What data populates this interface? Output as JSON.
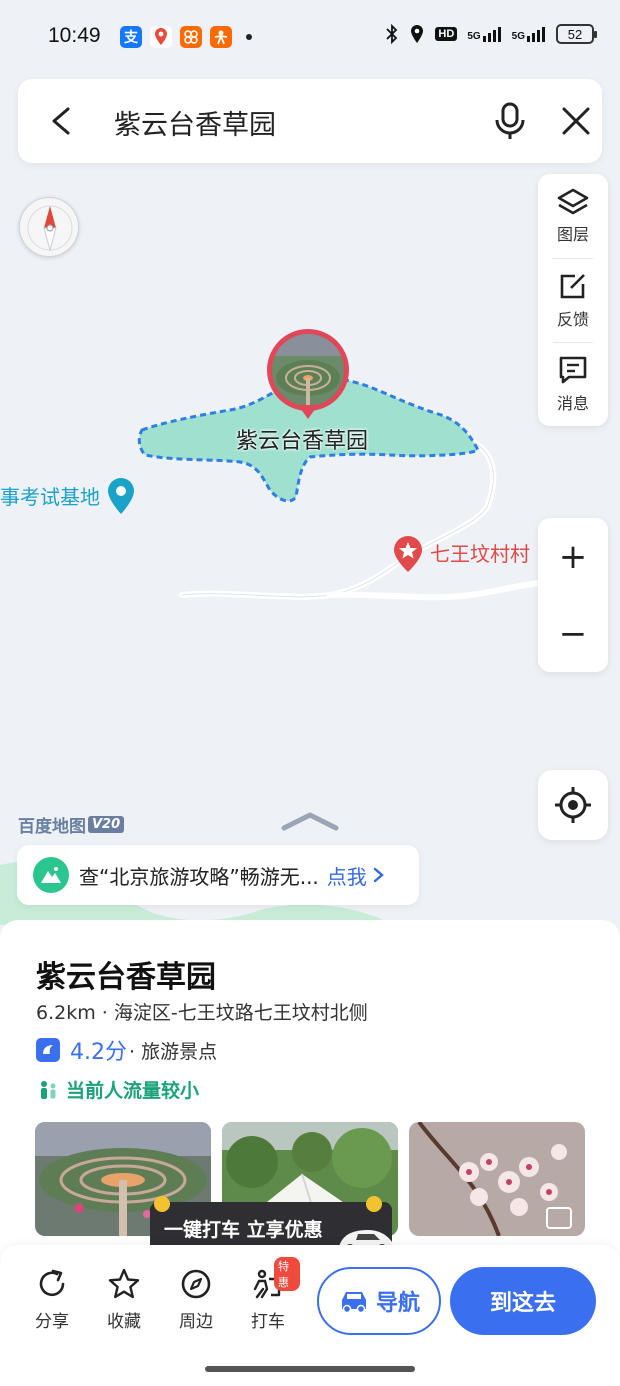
{
  "status_bar": {
    "time": "10:49",
    "apps": [
      {
        "icon": "alipay-icon",
        "glyph": "支",
        "color": "#1677ff"
      },
      {
        "icon": "map-pin-app-icon",
        "glyph": "",
        "color": "#ffffff"
      },
      {
        "icon": "app-grid-icon",
        "glyph": "",
        "color": "#ff6a00"
      },
      {
        "icon": "person-app-icon",
        "glyph": "",
        "color": "#ff6a00"
      }
    ],
    "hd_label": "HD",
    "network_1": "5G",
    "network_2": "5G",
    "battery": "52"
  },
  "search": {
    "query": "紫云台香草园"
  },
  "map_tools": {
    "layers_label": "图层",
    "feedback_label": "反馈",
    "messages_label": "消息"
  },
  "zoom": {
    "in_label": "+",
    "out_label": "−"
  },
  "map_labels": {
    "park_name": "紫云台香草园",
    "exam_base": "事考试基地",
    "village": "七王坟村村"
  },
  "logo": {
    "text": "百度地图",
    "version": "V20"
  },
  "promo": {
    "text": "查“北京旅游攻略”畅游无...",
    "link": "点我"
  },
  "place": {
    "name": "紫云台香草园",
    "address": "6.2km · 海淀区-七王坟路七王坟村北侧",
    "rating": "4.2分",
    "category": "· 旅游景点",
    "crowd": "当前人流量较小"
  },
  "taxi_promo": {
    "text": "一键打车 立享优惠"
  },
  "actions": {
    "share": "分享",
    "favorite": "收藏",
    "nearby": "周边",
    "taxi": "打车",
    "taxi_badge": "特惠",
    "navigate": "导航",
    "go_there": "到这去"
  },
  "colors": {
    "accent": "#3a6ff0",
    "park_fill": "#9fe0cf",
    "park_border": "#2f7ee6",
    "crowd_green": "#1aa37a",
    "village_red": "#e04a4a",
    "exam_teal": "#1aa3c8"
  }
}
